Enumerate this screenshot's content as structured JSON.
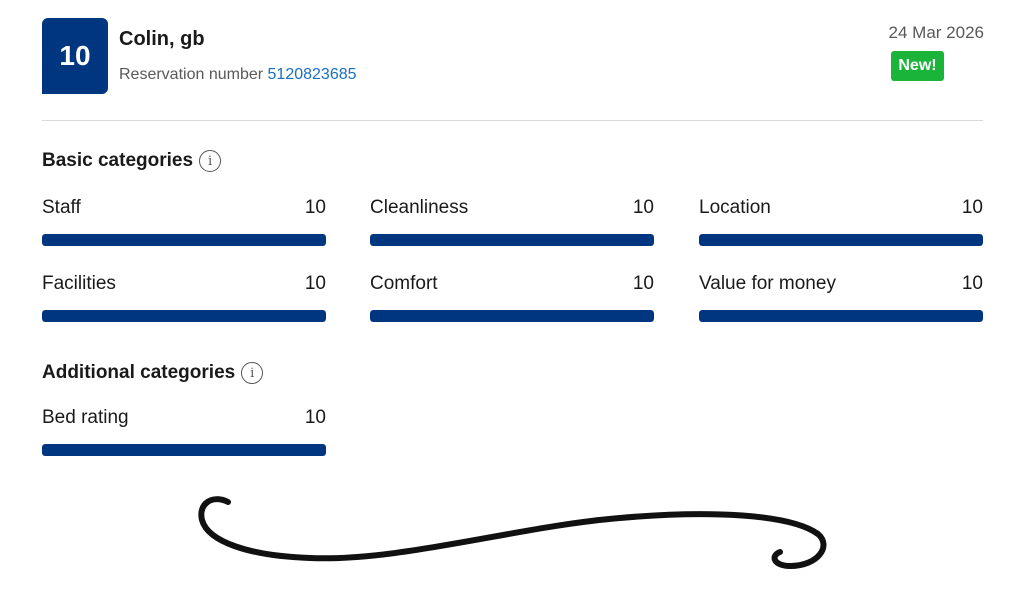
{
  "review": {
    "score": "10",
    "reviewer": "Colin, gb",
    "reservation_label": "Reservation number",
    "reservation_number": "5120823685",
    "date": "24 Mar 2026",
    "badge": "New!"
  },
  "basic": {
    "title": "Basic categories",
    "info_icon": "i",
    "items": [
      {
        "label": "Staff",
        "score": "10",
        "fill": 1.0
      },
      {
        "label": "Cleanliness",
        "score": "10",
        "fill": 1.0
      },
      {
        "label": "Location",
        "score": "10",
        "fill": 1.0
      },
      {
        "label": "Facilities",
        "score": "10",
        "fill": 1.0
      },
      {
        "label": "Comfort",
        "score": "10",
        "fill": 1.0
      },
      {
        "label": "Value for money",
        "score": "10",
        "fill": 1.0
      }
    ]
  },
  "additional": {
    "title": "Additional categories",
    "info_icon": "i",
    "items": [
      {
        "label": "Bed rating",
        "score": "10",
        "fill": 1.0
      }
    ]
  },
  "colors": {
    "brand_blue": "#003580",
    "new_green": "#1bb43b",
    "link_blue": "#1a6fc1"
  }
}
